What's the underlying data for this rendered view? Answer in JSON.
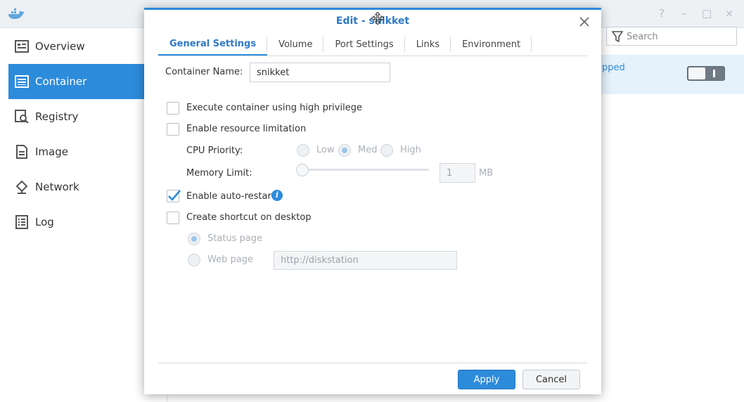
{
  "app": {
    "nav": [
      {
        "label": "Overview",
        "icon": "overview-icon"
      },
      {
        "label": "Container",
        "icon": "container-icon",
        "active": true
      },
      {
        "label": "Registry",
        "icon": "registry-icon"
      },
      {
        "label": "Image",
        "icon": "image-icon"
      },
      {
        "label": "Network",
        "icon": "network-icon"
      },
      {
        "label": "Log",
        "icon": "log-icon"
      }
    ],
    "search_placeholder": "Search",
    "row_status": "opped",
    "window_controls": [
      "?",
      "–",
      "□",
      "×"
    ]
  },
  "dialog": {
    "title": "Edit - snikket",
    "tabs": [
      "General Settings",
      "Volume",
      "Port Settings",
      "Links",
      "Environment"
    ],
    "active_tab": "General Settings",
    "container_name_label": "Container Name:",
    "container_name_value": "snikket",
    "high_privilege_label": "Execute container using high privilege",
    "resource_limit_label": "Enable resource limitation",
    "cpu_priority_label": "CPU Priority:",
    "cpu_options": [
      "Low",
      "Med",
      "High"
    ],
    "cpu_selected": "Med",
    "memory_limit_label": "Memory Limit:",
    "memory_value": "1",
    "memory_unit": "MB",
    "auto_restart_label": "Enable auto-restart",
    "auto_restart_checked": true,
    "shortcut_label": "Create shortcut on desktop",
    "status_page_label": "Status page",
    "web_page_label": "Web page",
    "web_page_value": "http://diskstation",
    "apply_label": "Apply",
    "cancel_label": "Cancel"
  },
  "colors": {
    "accent": "#2d8bdb",
    "title": "#2d79c7"
  }
}
